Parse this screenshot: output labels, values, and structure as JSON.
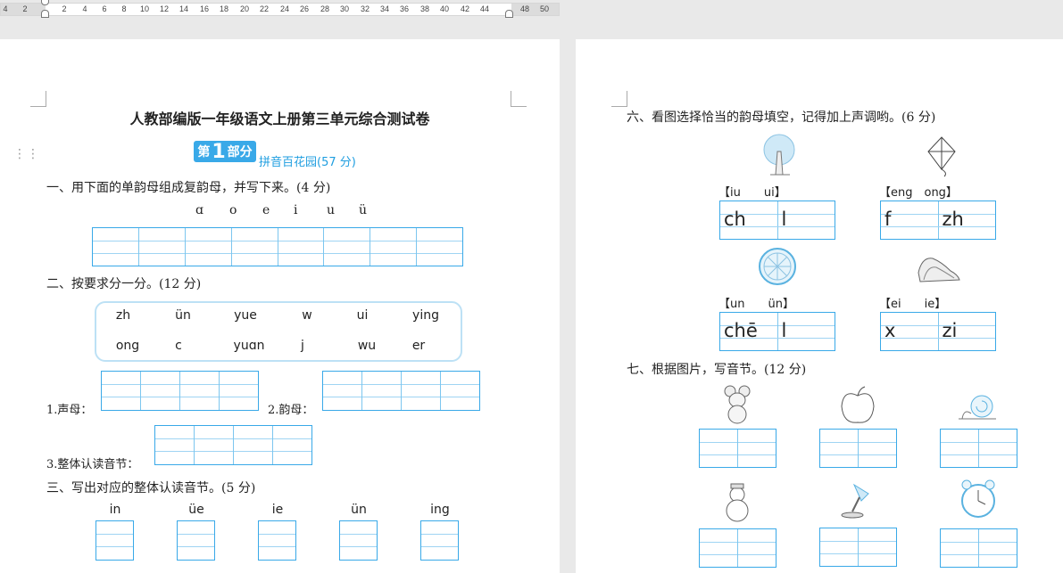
{
  "ruler": {
    "ticks": [
      "4",
      "2",
      "2",
      "4",
      "6",
      "8",
      "10",
      "12",
      "14",
      "16",
      "18",
      "20",
      "22",
      "24",
      "26",
      "28",
      "30",
      "32",
      "34",
      "36",
      "38",
      "40",
      "42",
      "44",
      "48",
      "50"
    ]
  },
  "left": {
    "title": "人教部编版一年级语文上册第三单元综合测试卷",
    "badge": {
      "pre": "第",
      "num": "1",
      "post": "部分"
    },
    "badge_sub": "拼音百花园(57 分)",
    "q1": "一、用下面的单韵母组成复韵母，并写下来。(4 分)",
    "vowels": [
      "ɑ",
      "o",
      "e",
      "i",
      "u",
      "ü"
    ],
    "q2": "二、按要求分一分。(12 分)",
    "syllables_row1": [
      "zh",
      "ün",
      "yue",
      "w",
      "ui",
      "ying"
    ],
    "syllables_row2": [
      "ong",
      "c",
      "yuɑn",
      "j",
      "wu",
      "er"
    ],
    "label_shengmu": "1.声母：",
    "label_yunmu": "2.韵母：",
    "label_zhengti": "3.整体认读音节：",
    "q3": "三、写出对应的整体认读音节。(5 分)",
    "q3_items": [
      "in",
      "üe",
      "ie",
      "ün",
      "ing"
    ]
  },
  "right": {
    "q6": "六、看图选择恰当的韵母填空，记得加上声调哟。(6 分)",
    "q6_items": [
      {
        "icon": "tree-icon",
        "options": "【iu　　ui】",
        "c1": "ch",
        "c2": "l"
      },
      {
        "icon": "kite-icon",
        "options": "【eng　ong】",
        "c1": "f",
        "c2": "zh"
      },
      {
        "icon": "wheel-icon",
        "options": "【un　　ün】",
        "c1": "chē",
        "c2": "l"
      },
      {
        "icon": "shoes-icon",
        "options": "【ei　　ie】",
        "c1": "x",
        "c2": "zi"
      }
    ],
    "q7": "七、根据图片，写音节。(12 分)",
    "q7_icons": [
      "mouse-icon",
      "apple-icon",
      "snail-icon",
      "snowman-icon",
      "lamp-icon",
      "clock-icon"
    ]
  }
}
